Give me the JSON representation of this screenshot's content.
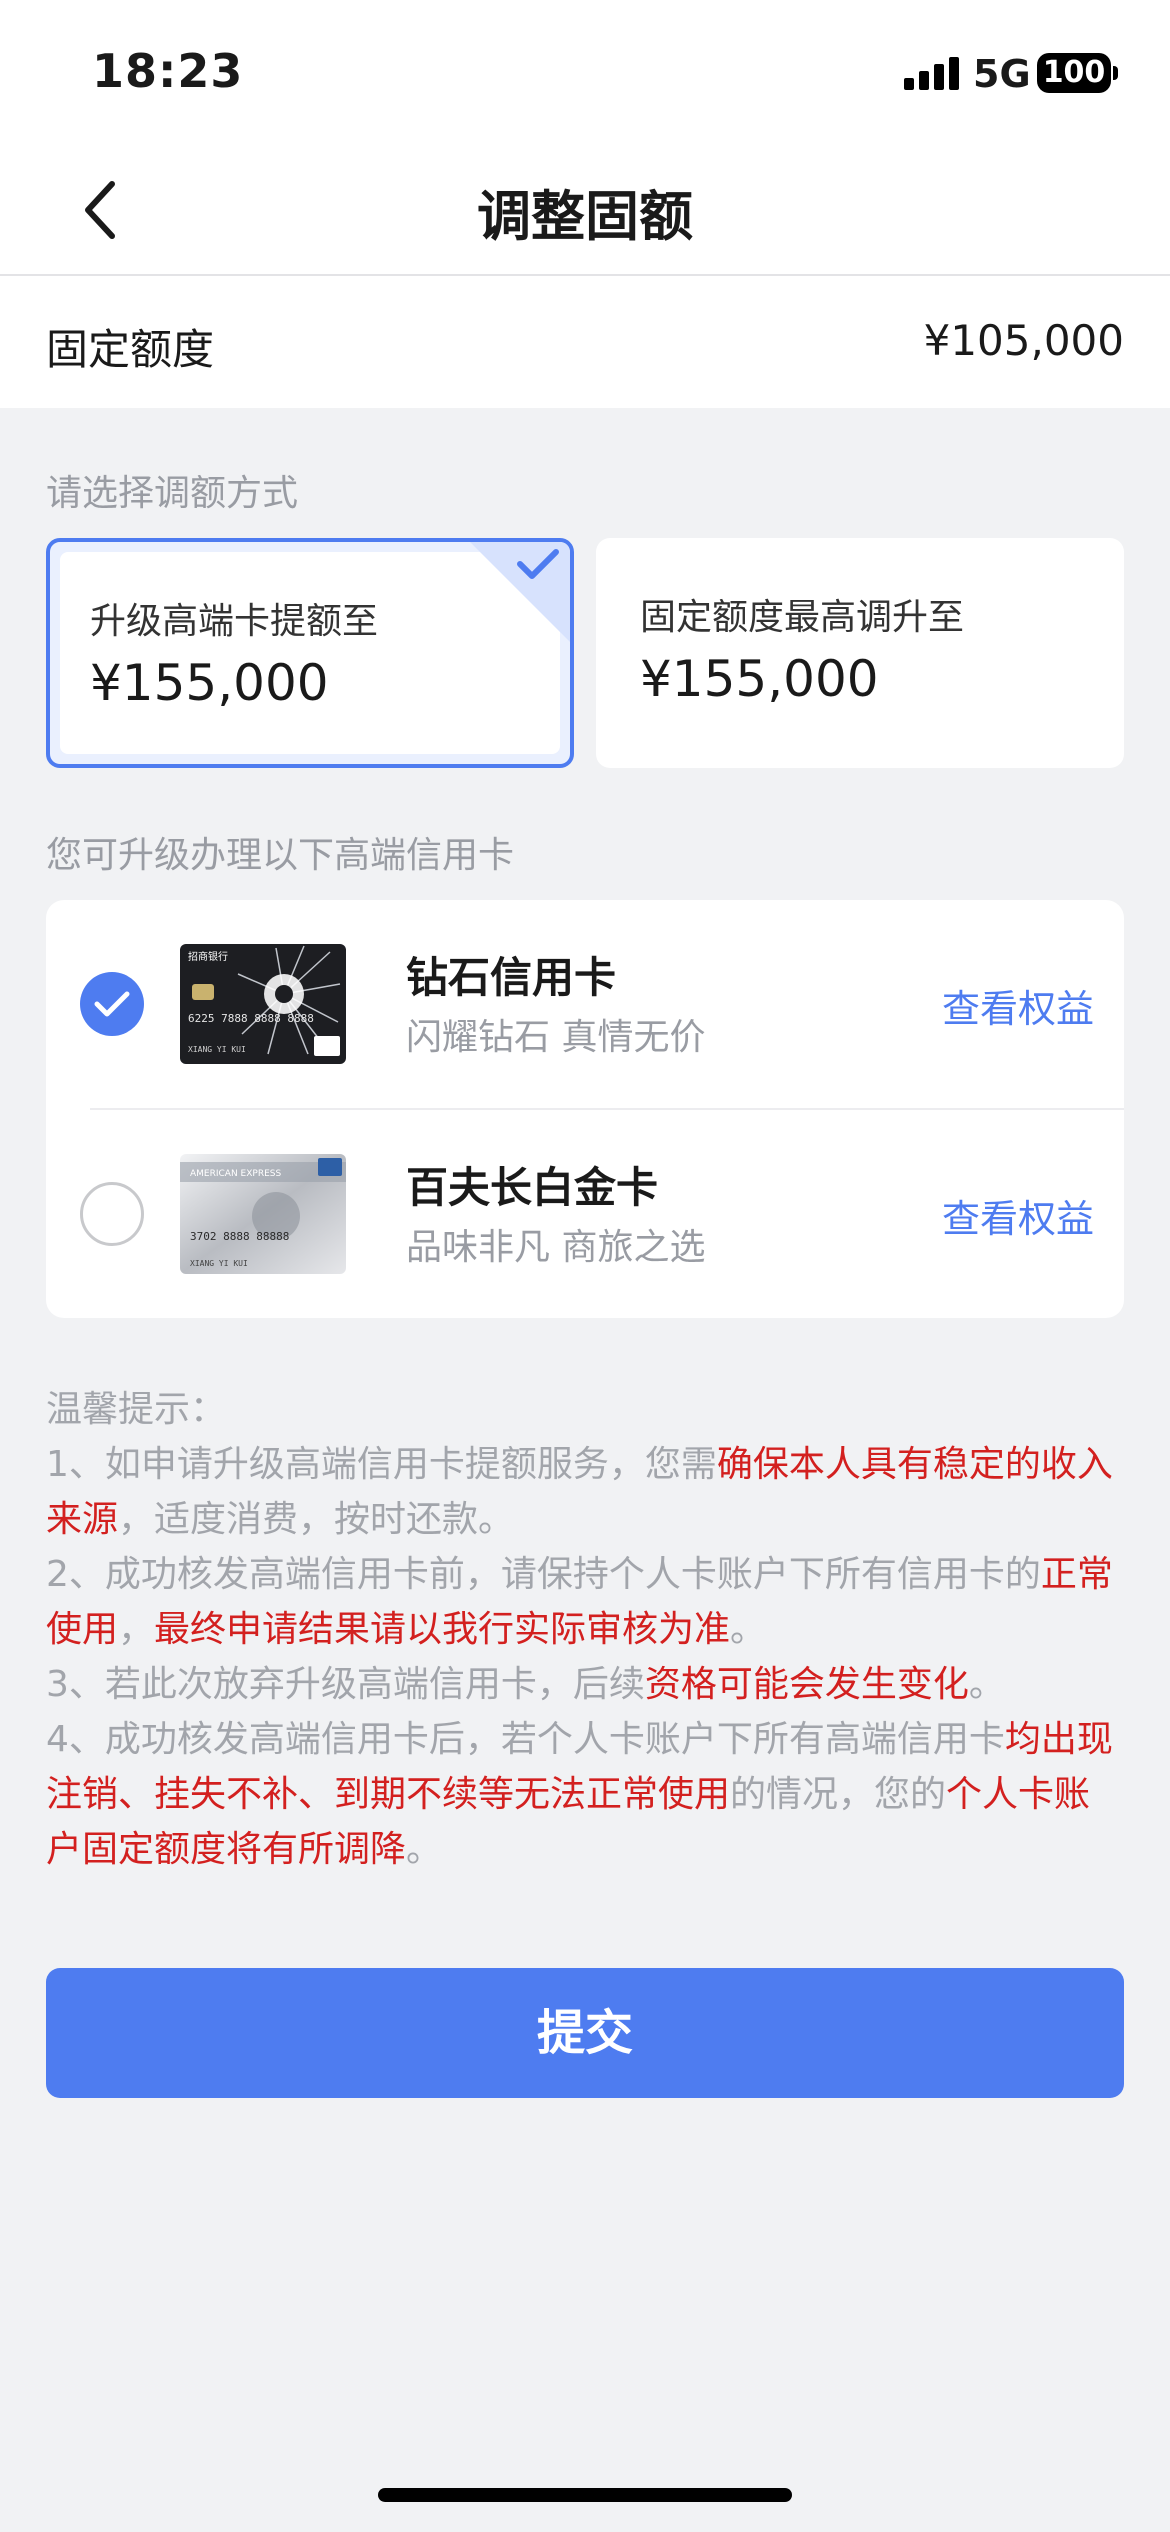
{
  "status_bar": {
    "time": "18:23",
    "network": "5G",
    "battery": "100"
  },
  "nav": {
    "title": "调整固额"
  },
  "fixed_limit": {
    "label": "固定额度",
    "value": "¥105,000"
  },
  "method_section": {
    "label": "请选择调额方式"
  },
  "methods": [
    {
      "title": "升级高端卡提额至",
      "amount": "¥155,000",
      "selected": true
    },
    {
      "title": "固定额度最高调升至",
      "amount": "¥155,000",
      "selected": false
    }
  ],
  "cards_section": {
    "label": "您可升级办理以下高端信用卡"
  },
  "cards": [
    {
      "name": "钻石信用卡",
      "desc": "闪耀钻石 真情无价",
      "link": "查看权益",
      "selected": true
    },
    {
      "name": "百夫长白金卡",
      "desc": "品味非凡 商旅之选",
      "link": "查看权益",
      "selected": false
    }
  ],
  "card_image_text": {
    "bank": "招商银行",
    "number": "6225 7888 8888 8888",
    "holder": "XIANG YI KUI",
    "amex_brand": "AMERICAN EXPRESS",
    "amex_number": "3702 8888 88888"
  },
  "notes": {
    "title": "温馨提示：",
    "n1": [
      "1、如申请升级高端信用卡提额服务，您需",
      "确保本人具有稳定的收入来源",
      "，适度消费，按时还款。"
    ],
    "n2": [
      "2、成功核发高端信用卡前，请保持个人卡账户下所有信用卡的",
      "正常使用",
      "，",
      "最终申请结果请以我行实际审核为准",
      "。"
    ],
    "n3": [
      "3、若此次放弃升级高端信用卡，后续",
      "资格可能会发生变化",
      "。"
    ],
    "n4": [
      "4、成功核发高端信用卡后，若个人卡账户下所有高端信用卡",
      "均出现注销、挂失不补、到期不续等无法正常使用",
      "的情况，您的",
      "个人卡账户固定额度将有所调降",
      "。"
    ]
  },
  "submit": {
    "label": "提交"
  },
  "colors": {
    "accent": "#4e7cf0",
    "warning": "#d3201f",
    "muted": "#999ca3",
    "background": "#f1f2f4"
  },
  "icons": {
    "back": "chevron-left-icon",
    "check": "check-icon",
    "signal": "signal-bars-icon"
  }
}
